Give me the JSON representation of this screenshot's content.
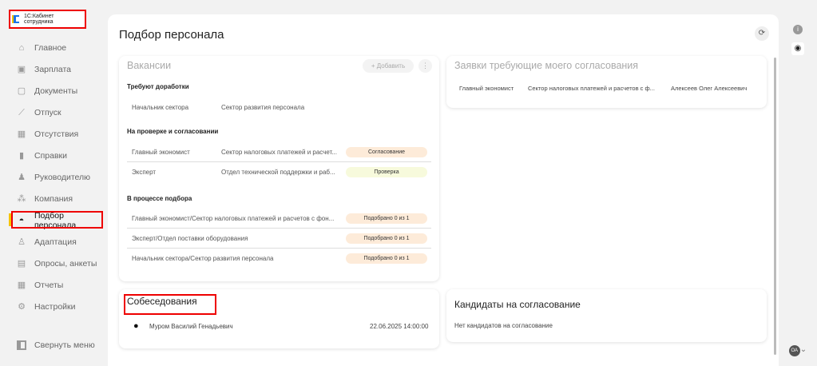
{
  "app": {
    "brand": "1С:Кабинет сотрудника"
  },
  "sidebar": {
    "items": [
      {
        "label": "Главное",
        "icon": "home-icon"
      },
      {
        "label": "Зарплата",
        "icon": "wallet-icon"
      },
      {
        "label": "Документы",
        "icon": "document-icon"
      },
      {
        "label": "Отпуск",
        "icon": "palm-icon"
      },
      {
        "label": "Отсутствия",
        "icon": "calendar-icon"
      },
      {
        "label": "Справки",
        "icon": "file-icon"
      },
      {
        "label": "Руководителю",
        "icon": "manager-icon"
      },
      {
        "label": "Компания",
        "icon": "people-icon"
      },
      {
        "label": "Подбор персонала",
        "icon": "spy-icon"
      },
      {
        "label": "Адаптация",
        "icon": "adaptation-icon"
      },
      {
        "label": "Опросы, анкеты",
        "icon": "survey-icon"
      },
      {
        "label": "Отчеты",
        "icon": "table-icon"
      },
      {
        "label": "Настройки",
        "icon": "gear-icon"
      }
    ],
    "collapse": "Свернуть меню"
  },
  "page": {
    "title": "Подбор персонала"
  },
  "vacancies": {
    "title": "Вакансии",
    "add": "+ Добавить",
    "groups": [
      {
        "label": "Требуют доработки",
        "rows": [
          {
            "position": "Начальник сектора",
            "dept": "Сектор развития персонала"
          }
        ]
      },
      {
        "label": "На проверке и согласовании",
        "rows": [
          {
            "position": "Главный экономист",
            "dept": "Сектор налоговых платежей и расчет...",
            "status": "Согласование",
            "color": "#fdebd9"
          },
          {
            "position": "Эксперт",
            "dept": "Отдел технической поддержки и раб...",
            "status": "Проверка",
            "color": "#f7fadc"
          }
        ]
      },
      {
        "label": "В процессе подбора",
        "rows": [
          {
            "position": "Главный экономист/Сектор налоговых платежей и расчетов с фон...",
            "status": "Подобрано 0 из 1",
            "color": "#fdebd9"
          },
          {
            "position": "Эксперт/Отдел поставки оборудования",
            "status": "Подобрано 0 из 1",
            "color": "#fdebd9"
          },
          {
            "position": "Начальник сектора/Сектор развития персонала",
            "status": "Подобрано 0 из 1",
            "color": "#fdebd9"
          }
        ]
      }
    ]
  },
  "requests": {
    "title": "Заявки требующие моего согласования",
    "row": {
      "position": "Главный экономист",
      "dept": "Сектор налоговых платежей и расчетов с ф...",
      "person": "Алексеев Олег Алексеевич"
    }
  },
  "interviews": {
    "title": "Собеседования",
    "row": {
      "name": "Муром Василий Генадьевич",
      "datetime": "22.06.2025 14:00:00"
    }
  },
  "candidates": {
    "title": "Кандидаты на согласование",
    "empty": "Нет кандидатов на согласование"
  },
  "user": {
    "initials": "ОА"
  }
}
